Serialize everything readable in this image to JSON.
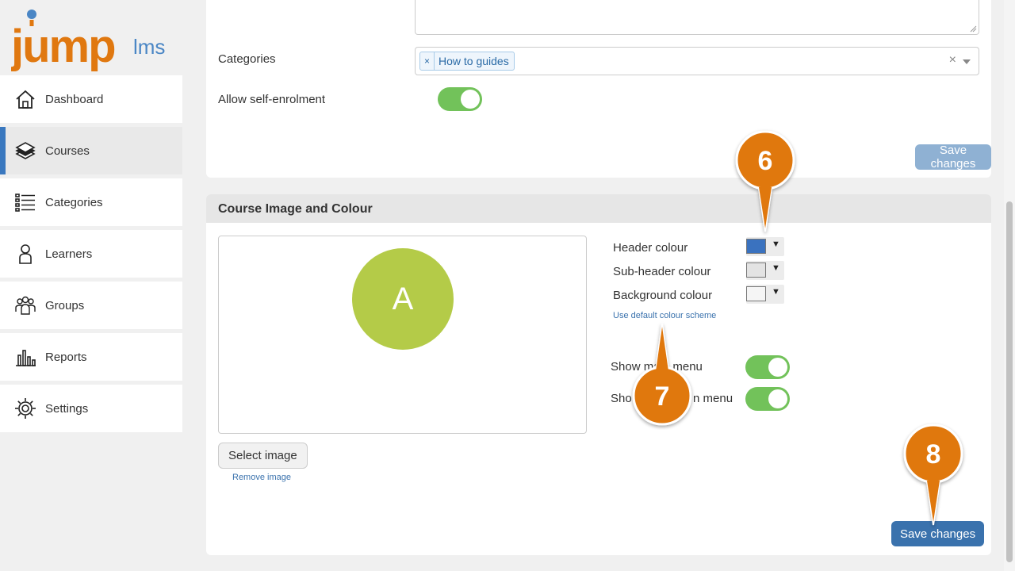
{
  "brand": {
    "name_left": "jump",
    "name_right": "lms"
  },
  "sidebar": {
    "items": [
      {
        "label": "Dashboard",
        "icon": "home-icon",
        "active": false
      },
      {
        "label": "Courses",
        "icon": "books-icon",
        "active": true
      },
      {
        "label": "Categories",
        "icon": "list-icon",
        "active": false
      },
      {
        "label": "Learners",
        "icon": "person-icon",
        "active": false
      },
      {
        "label": "Groups",
        "icon": "group-icon",
        "active": false
      },
      {
        "label": "Reports",
        "icon": "bar-chart-icon",
        "active": false
      },
      {
        "label": "Settings",
        "icon": "gear-icon",
        "active": false
      }
    ]
  },
  "details": {
    "categories_label": "Categories",
    "category_tags": [
      "How to guides"
    ],
    "tag_remove": "×",
    "clear_symbol": "×",
    "self_enrol_label": "Allow self-enrolment",
    "self_enrol_on": true,
    "save_label": "Save changes"
  },
  "image_colour": {
    "title": "Course Image and Colour",
    "avatar_letter": "A",
    "avatar_color": "#b4cb48",
    "select_image_label": "Select image",
    "remove_image_label": "Remove image",
    "header_colour_label": "Header colour",
    "header_colour": "#3a72bf",
    "subheader_colour_label": "Sub-header colour",
    "subheader_colour": "#e3e3e3",
    "background_colour_label": "Background colour",
    "background_colour": "#f5f5f5",
    "dropdown_arrow": "▼",
    "default_scheme_label": "Use default colour scheme",
    "show_main_menu_label": "Show main menu",
    "show_main_menu_on": true,
    "show_second_menu_label_start": "Sho",
    "show_second_menu_label_end": "n menu",
    "show_second_menu_on": true,
    "save_label": "Save changes"
  },
  "callouts": {
    "marker_color": "#e07810",
    "items": [
      {
        "number": "6"
      },
      {
        "number": "7"
      },
      {
        "number": "8"
      }
    ]
  }
}
